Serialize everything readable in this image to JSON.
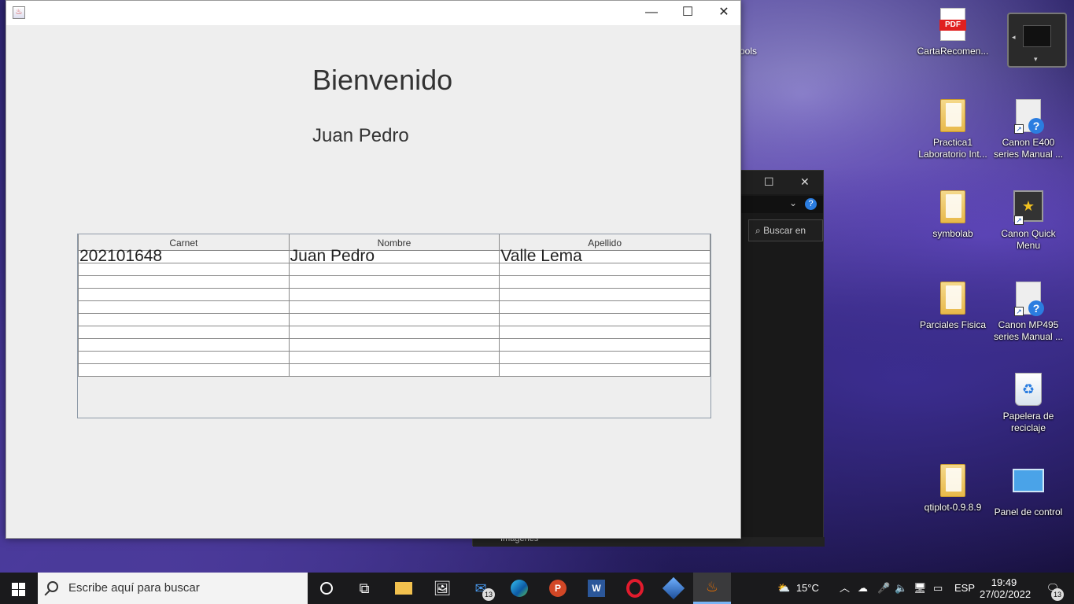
{
  "window": {
    "welcome": "Bienvenido",
    "user_name": "Juan Pedro",
    "controls": {
      "minimize": "—",
      "maximize": "☐",
      "close": "✕"
    }
  },
  "table": {
    "headers": [
      "Carnet",
      "Nombre",
      "Apellido"
    ],
    "rows": [
      [
        "202101648",
        "Juan Pedro",
        "Valle Lema"
      ],
      [
        "",
        "",
        ""
      ],
      [
        "",
        "",
        ""
      ],
      [
        "",
        "",
        ""
      ],
      [
        "",
        "",
        ""
      ],
      [
        "",
        "",
        ""
      ],
      [
        "",
        "",
        ""
      ],
      [
        "",
        "",
        ""
      ],
      [
        "",
        "",
        ""
      ],
      [
        "",
        "",
        ""
      ]
    ]
  },
  "background_window": {
    "search_placeholder": "Buscar en",
    "bottom_item": "Imágenes",
    "partial_label": "ools"
  },
  "desktop_icons": [
    {
      "label": "CartaRecomen...",
      "type": "pdf",
      "icon": "pdf-icon"
    },
    {
      "label": "Practica1 Laboratorio Int...",
      "type": "folder",
      "icon": "folder-icon"
    },
    {
      "label": "Canon E400 series Manual ...",
      "type": "shortcut",
      "icon": "help-shortcut-icon"
    },
    {
      "label": "symbolab",
      "type": "folder",
      "icon": "folder-icon"
    },
    {
      "label": "Canon Quick Menu",
      "type": "shortcut",
      "icon": "canon-quick-menu-icon"
    },
    {
      "label": "Parciales Fisica",
      "type": "folder",
      "icon": "folder-icon"
    },
    {
      "label": "Canon MP495 series Manual ...",
      "type": "shortcut",
      "icon": "help-shortcut-icon"
    },
    {
      "label": "Papelera de reciclaje",
      "type": "bin",
      "icon": "recycle-bin-icon"
    },
    {
      "label": "qtiplot-0.9.8.9",
      "type": "folder",
      "icon": "folder-icon"
    },
    {
      "label": "Panel de control",
      "type": "panel",
      "icon": "control-panel-icon"
    }
  ],
  "taskbar": {
    "search_placeholder": "Escribe aquí para buscar",
    "weather": "15°C",
    "language": "ESP",
    "time": "19:49",
    "date": "27/02/2022",
    "mail_badge": "13",
    "notification_badge": "13"
  },
  "colors": {
    "accent": "#7ab4f5",
    "taskbar": "#1a1a1c",
    "window_bg": "#eeeeee"
  }
}
